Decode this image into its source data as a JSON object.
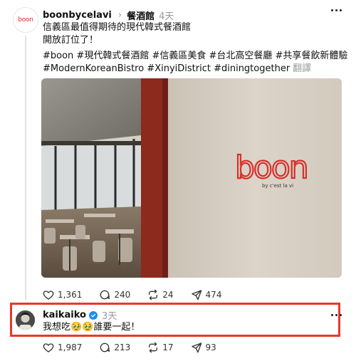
{
  "post": {
    "avatar_text": "boon",
    "username": "boonbycelavi",
    "topic": "餐酒館",
    "time": "4天",
    "lines": [
      "信義區最值得期待的現代韓式餐酒館",
      "開放訂位了！",
      "#boon #現代韓式餐酒館 #信義區美食 #台北高空餐廳 #共享餐飲新體驗",
      "#ModernKoreanBistro #XinyiDistrict #diningtogether"
    ],
    "translate": "翻譯",
    "image": {
      "wall_logo": "boon",
      "wall_sub": "by c'est la vi"
    },
    "likes": "1,361",
    "comments": "240",
    "reposts": "24",
    "shares": "474"
  },
  "reply": {
    "username": "kaikaiko",
    "time": "3天",
    "text": "我想吃🥹🥹誰要一起！",
    "likes": "1,987",
    "comments": "213",
    "reposts": "17",
    "shares": "93"
  },
  "colors": {
    "highlight": "#e8382b",
    "brand_red": "#d8302c",
    "verified": "#1f8bf5"
  },
  "icons": [
    "heart-icon",
    "comment-icon",
    "repost-icon",
    "share-icon",
    "more-icon",
    "verified-badge-icon",
    "chevron-right-icon"
  ]
}
